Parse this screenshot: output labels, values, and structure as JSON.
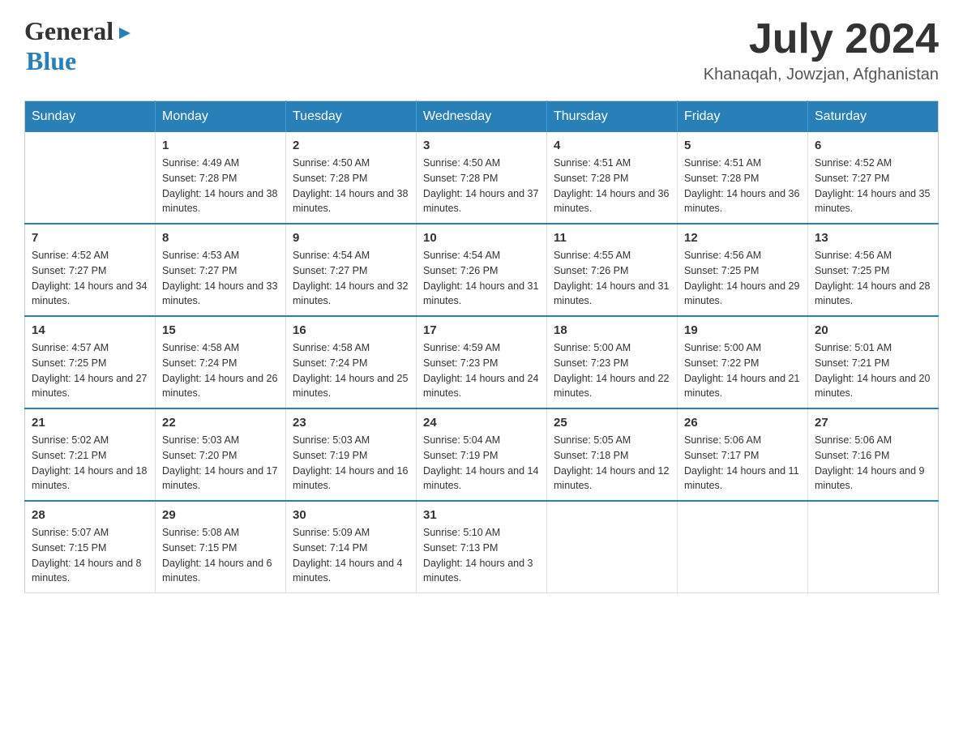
{
  "header": {
    "month_year": "July 2024",
    "location": "Khanaqah, Jowzjan, Afghanistan",
    "logo_general": "General",
    "logo_blue": "Blue"
  },
  "days_of_week": [
    "Sunday",
    "Monday",
    "Tuesday",
    "Wednesday",
    "Thursday",
    "Friday",
    "Saturday"
  ],
  "weeks": [
    [
      {
        "day": "",
        "sunrise": "",
        "sunset": "",
        "daylight": ""
      },
      {
        "day": "1",
        "sunrise": "Sunrise: 4:49 AM",
        "sunset": "Sunset: 7:28 PM",
        "daylight": "Daylight: 14 hours and 38 minutes."
      },
      {
        "day": "2",
        "sunrise": "Sunrise: 4:50 AM",
        "sunset": "Sunset: 7:28 PM",
        "daylight": "Daylight: 14 hours and 38 minutes."
      },
      {
        "day": "3",
        "sunrise": "Sunrise: 4:50 AM",
        "sunset": "Sunset: 7:28 PM",
        "daylight": "Daylight: 14 hours and 37 minutes."
      },
      {
        "day": "4",
        "sunrise": "Sunrise: 4:51 AM",
        "sunset": "Sunset: 7:28 PM",
        "daylight": "Daylight: 14 hours and 36 minutes."
      },
      {
        "day": "5",
        "sunrise": "Sunrise: 4:51 AM",
        "sunset": "Sunset: 7:28 PM",
        "daylight": "Daylight: 14 hours and 36 minutes."
      },
      {
        "day": "6",
        "sunrise": "Sunrise: 4:52 AM",
        "sunset": "Sunset: 7:27 PM",
        "daylight": "Daylight: 14 hours and 35 minutes."
      }
    ],
    [
      {
        "day": "7",
        "sunrise": "Sunrise: 4:52 AM",
        "sunset": "Sunset: 7:27 PM",
        "daylight": "Daylight: 14 hours and 34 minutes."
      },
      {
        "day": "8",
        "sunrise": "Sunrise: 4:53 AM",
        "sunset": "Sunset: 7:27 PM",
        "daylight": "Daylight: 14 hours and 33 minutes."
      },
      {
        "day": "9",
        "sunrise": "Sunrise: 4:54 AM",
        "sunset": "Sunset: 7:27 PM",
        "daylight": "Daylight: 14 hours and 32 minutes."
      },
      {
        "day": "10",
        "sunrise": "Sunrise: 4:54 AM",
        "sunset": "Sunset: 7:26 PM",
        "daylight": "Daylight: 14 hours and 31 minutes."
      },
      {
        "day": "11",
        "sunrise": "Sunrise: 4:55 AM",
        "sunset": "Sunset: 7:26 PM",
        "daylight": "Daylight: 14 hours and 31 minutes."
      },
      {
        "day": "12",
        "sunrise": "Sunrise: 4:56 AM",
        "sunset": "Sunset: 7:25 PM",
        "daylight": "Daylight: 14 hours and 29 minutes."
      },
      {
        "day": "13",
        "sunrise": "Sunrise: 4:56 AM",
        "sunset": "Sunset: 7:25 PM",
        "daylight": "Daylight: 14 hours and 28 minutes."
      }
    ],
    [
      {
        "day": "14",
        "sunrise": "Sunrise: 4:57 AM",
        "sunset": "Sunset: 7:25 PM",
        "daylight": "Daylight: 14 hours and 27 minutes."
      },
      {
        "day": "15",
        "sunrise": "Sunrise: 4:58 AM",
        "sunset": "Sunset: 7:24 PM",
        "daylight": "Daylight: 14 hours and 26 minutes."
      },
      {
        "day": "16",
        "sunrise": "Sunrise: 4:58 AM",
        "sunset": "Sunset: 7:24 PM",
        "daylight": "Daylight: 14 hours and 25 minutes."
      },
      {
        "day": "17",
        "sunrise": "Sunrise: 4:59 AM",
        "sunset": "Sunset: 7:23 PM",
        "daylight": "Daylight: 14 hours and 24 minutes."
      },
      {
        "day": "18",
        "sunrise": "Sunrise: 5:00 AM",
        "sunset": "Sunset: 7:23 PM",
        "daylight": "Daylight: 14 hours and 22 minutes."
      },
      {
        "day": "19",
        "sunrise": "Sunrise: 5:00 AM",
        "sunset": "Sunset: 7:22 PM",
        "daylight": "Daylight: 14 hours and 21 minutes."
      },
      {
        "day": "20",
        "sunrise": "Sunrise: 5:01 AM",
        "sunset": "Sunset: 7:21 PM",
        "daylight": "Daylight: 14 hours and 20 minutes."
      }
    ],
    [
      {
        "day": "21",
        "sunrise": "Sunrise: 5:02 AM",
        "sunset": "Sunset: 7:21 PM",
        "daylight": "Daylight: 14 hours and 18 minutes."
      },
      {
        "day": "22",
        "sunrise": "Sunrise: 5:03 AM",
        "sunset": "Sunset: 7:20 PM",
        "daylight": "Daylight: 14 hours and 17 minutes."
      },
      {
        "day": "23",
        "sunrise": "Sunrise: 5:03 AM",
        "sunset": "Sunset: 7:19 PM",
        "daylight": "Daylight: 14 hours and 16 minutes."
      },
      {
        "day": "24",
        "sunrise": "Sunrise: 5:04 AM",
        "sunset": "Sunset: 7:19 PM",
        "daylight": "Daylight: 14 hours and 14 minutes."
      },
      {
        "day": "25",
        "sunrise": "Sunrise: 5:05 AM",
        "sunset": "Sunset: 7:18 PM",
        "daylight": "Daylight: 14 hours and 12 minutes."
      },
      {
        "day": "26",
        "sunrise": "Sunrise: 5:06 AM",
        "sunset": "Sunset: 7:17 PM",
        "daylight": "Daylight: 14 hours and 11 minutes."
      },
      {
        "day": "27",
        "sunrise": "Sunrise: 5:06 AM",
        "sunset": "Sunset: 7:16 PM",
        "daylight": "Daylight: 14 hours and 9 minutes."
      }
    ],
    [
      {
        "day": "28",
        "sunrise": "Sunrise: 5:07 AM",
        "sunset": "Sunset: 7:15 PM",
        "daylight": "Daylight: 14 hours and 8 minutes."
      },
      {
        "day": "29",
        "sunrise": "Sunrise: 5:08 AM",
        "sunset": "Sunset: 7:15 PM",
        "daylight": "Daylight: 14 hours and 6 minutes."
      },
      {
        "day": "30",
        "sunrise": "Sunrise: 5:09 AM",
        "sunset": "Sunset: 7:14 PM",
        "daylight": "Daylight: 14 hours and 4 minutes."
      },
      {
        "day": "31",
        "sunrise": "Sunrise: 5:10 AM",
        "sunset": "Sunset: 7:13 PM",
        "daylight": "Daylight: 14 hours and 3 minutes."
      },
      {
        "day": "",
        "sunrise": "",
        "sunset": "",
        "daylight": ""
      },
      {
        "day": "",
        "sunrise": "",
        "sunset": "",
        "daylight": ""
      },
      {
        "day": "",
        "sunrise": "",
        "sunset": "",
        "daylight": ""
      }
    ]
  ]
}
